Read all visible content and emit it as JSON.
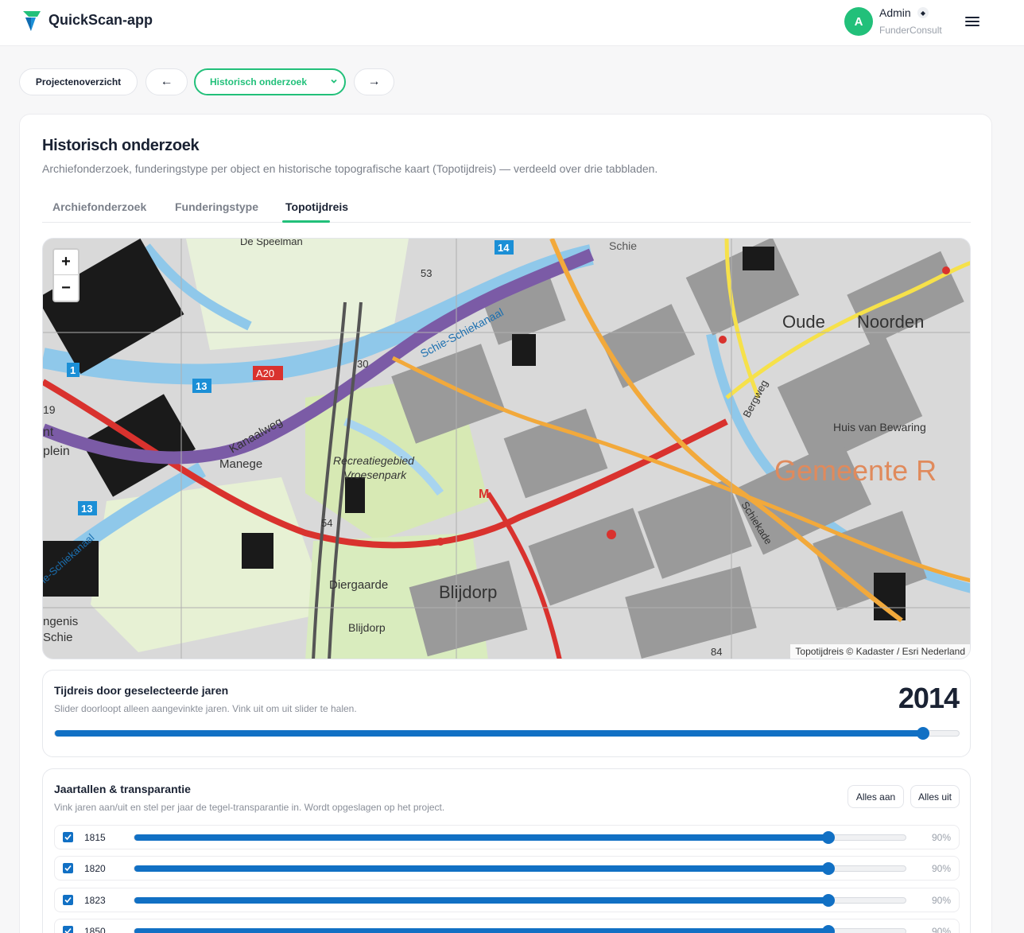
{
  "app": {
    "name": "QuickScan-app",
    "brand_color": "#22c07a",
    "accent": "#1170c4"
  },
  "user": {
    "initial": "A",
    "name": "Admin",
    "org": "FunderConsult"
  },
  "nav": {
    "projects_label": "Projectenoverzicht",
    "prev_label": "←",
    "section_select": "Historisch onderzoek",
    "next_label": "→"
  },
  "page": {
    "title": "Historisch onderzoek",
    "subtitle": "Archiefonderzoek, funderingstype per object en historische topografische kaart (Topotijdreis) — verdeeld over drie tabbladen."
  },
  "tabs": [
    {
      "label": "Archiefonderzoek",
      "active": false
    },
    {
      "label": "Funderingstype",
      "active": false
    },
    {
      "label": "Topotijdreis",
      "active": true
    }
  ],
  "map": {
    "zoom_in": "+",
    "zoom_out": "−",
    "attribution": "Topotijdreis © Kadaster / Esri Nederland",
    "labels": {
      "a20": "A20",
      "schie_kanaal": "Schie-Schiekanaal",
      "kanaalweg": "Kanaalweg",
      "manege": "Manege",
      "recreatie1": "Recreatiegebied",
      "recreatie2": "Vroesenpark",
      "diergaarde": "Diergaarde",
      "blijdorp": "Blijdorp",
      "blijdorp_small": "Blijdorp",
      "oude": "Oude",
      "noorden": "Noorden",
      "huis": "Huis van Bewaring",
      "gemeente": "Gemeente R",
      "bergweg": "Bergweg",
      "schiekade": "Schiekade",
      "speelman": "De Speelman",
      "schie_top": "Schie",
      "schie_left": "Schie",
      "ngenis": "ngenis",
      "plein": "plein",
      "schiekanaal_left": "ie-Schiekanaal",
      "n53": "53",
      "n54": "54",
      "n84": "84",
      "n30": "30",
      "n19": "19",
      "nt": "nt",
      "b14": "14",
      "b13a": "13",
      "b13b": "13",
      "b1": "1",
      "m": "M"
    }
  },
  "timeline": {
    "title": "Tijdreis door geselecteerde jaren",
    "subtitle": "Slider doorloopt alleen aangevinkte jaren. Vink uit om uit slider te halen.",
    "year": "2014",
    "position": 0.96
  },
  "years_panel": {
    "title": "Jaartallen & transparantie",
    "subtitle": "Vink jaren aan/uit en stel per jaar de tegel-transparantie in. Wordt opgeslagen op het project.",
    "all_on": "Alles aan",
    "all_off": "Alles uit",
    "rows": [
      {
        "year": "1815",
        "checked": true,
        "opacity": 0.9,
        "label": "90%"
      },
      {
        "year": "1820",
        "checked": true,
        "opacity": 0.9,
        "label": "90%"
      },
      {
        "year": "1823",
        "checked": true,
        "opacity": 0.9,
        "label": "90%"
      },
      {
        "year": "1850",
        "checked": true,
        "opacity": 0.9,
        "label": "90%"
      }
    ]
  }
}
